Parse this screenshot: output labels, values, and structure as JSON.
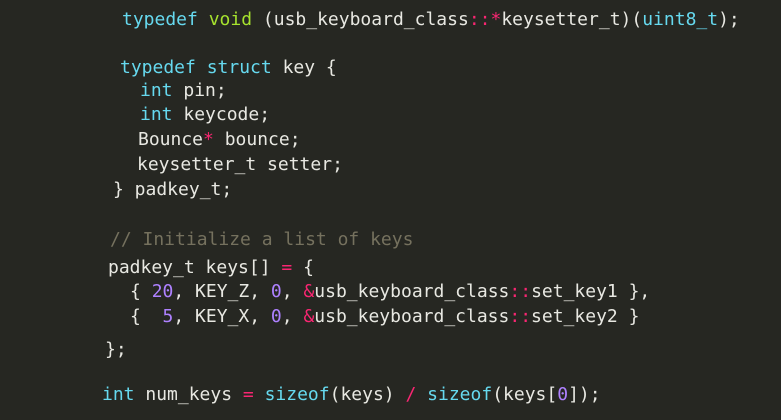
{
  "colors": {
    "background": "#262722",
    "keyword": "#66d9ef",
    "type": "#a6e22e",
    "operator": "#f92672",
    "number": "#ae81ff",
    "comment": "#75715e",
    "text": "#e8e8e2"
  },
  "lines": [
    [
      {
        "t": "typedef",
        "c": "kw"
      },
      {
        "t": " ",
        "c": "pl"
      },
      {
        "t": "void",
        "c": "type"
      },
      {
        "t": " (usb_keyboard_class",
        "c": "pl"
      },
      {
        "t": "::*",
        "c": "op"
      },
      {
        "t": "keysetter_t)(",
        "c": "pl"
      },
      {
        "t": "uint8_t",
        "c": "kw"
      },
      {
        "t": ");",
        "c": "pl"
      }
    ],
    [
      {
        "t": "typedef",
        "c": "kw"
      },
      {
        "t": " ",
        "c": "pl"
      },
      {
        "t": "struct",
        "c": "kw"
      },
      {
        "t": " key {",
        "c": "pl"
      }
    ],
    [
      {
        "t": "int",
        "c": "kw"
      },
      {
        "t": " pin;",
        "c": "pl"
      }
    ],
    [
      {
        "t": "int",
        "c": "kw"
      },
      {
        "t": " keycode;",
        "c": "pl"
      }
    ],
    [
      {
        "t": "Bounce",
        "c": "pl"
      },
      {
        "t": "*",
        "c": "op"
      },
      {
        "t": " bounce;",
        "c": "pl"
      }
    ],
    [
      {
        "t": "keysetter_t setter;",
        "c": "pl"
      }
    ],
    [
      {
        "t": "} padkey_t;",
        "c": "pl"
      }
    ],
    [
      {
        "t": "// Initialize a list of keys",
        "c": "cm"
      }
    ],
    [
      {
        "t": "padkey_t keys[] ",
        "c": "pl"
      },
      {
        "t": "=",
        "c": "op"
      },
      {
        "t": " {",
        "c": "pl"
      }
    ],
    [
      {
        "t": "{ ",
        "c": "pl"
      },
      {
        "t": "20",
        "c": "num"
      },
      {
        "t": ", KEY_Z, ",
        "c": "pl"
      },
      {
        "t": "0",
        "c": "num"
      },
      {
        "t": ", ",
        "c": "pl"
      },
      {
        "t": "&",
        "c": "op"
      },
      {
        "t": "usb_keyboard_class",
        "c": "pl"
      },
      {
        "t": "::",
        "c": "op"
      },
      {
        "t": "set_key1 },",
        "c": "pl"
      }
    ],
    [
      {
        "t": "{  ",
        "c": "pl"
      },
      {
        "t": "5",
        "c": "num"
      },
      {
        "t": ", KEY_X, ",
        "c": "pl"
      },
      {
        "t": "0",
        "c": "num"
      },
      {
        "t": ", ",
        "c": "pl"
      },
      {
        "t": "&",
        "c": "op"
      },
      {
        "t": "usb_keyboard_class",
        "c": "pl"
      },
      {
        "t": "::",
        "c": "op"
      },
      {
        "t": "set_key2 }",
        "c": "pl"
      }
    ],
    [
      {
        "t": "};",
        "c": "pl"
      }
    ],
    [
      {
        "t": "int",
        "c": "kw"
      },
      {
        "t": " num_keys ",
        "c": "pl"
      },
      {
        "t": "=",
        "c": "op"
      },
      {
        "t": " ",
        "c": "pl"
      },
      {
        "t": "sizeof",
        "c": "kw"
      },
      {
        "t": "(keys) ",
        "c": "pl"
      },
      {
        "t": "/",
        "c": "op"
      },
      {
        "t": " ",
        "c": "pl"
      },
      {
        "t": "sizeof",
        "c": "kw"
      },
      {
        "t": "(keys[",
        "c": "pl"
      },
      {
        "t": "0",
        "c": "num"
      },
      {
        "t": "]);",
        "c": "pl"
      }
    ]
  ]
}
